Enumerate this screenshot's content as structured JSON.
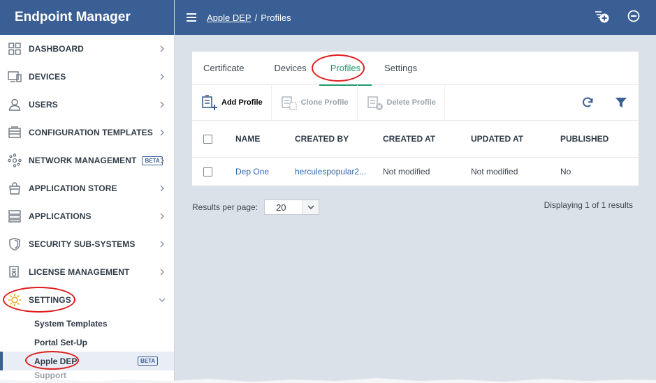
{
  "app": {
    "title": "Endpoint Manager"
  },
  "colors": {
    "brand": "#3a5f95",
    "accent_green": "#1e9a6a",
    "link": "#2f67a8",
    "annotation": "#e01b1b"
  },
  "sidebar": {
    "items": [
      {
        "label": "DASHBOARD",
        "icon": "dashboard-icon"
      },
      {
        "label": "DEVICES",
        "icon": "devices-icon"
      },
      {
        "label": "USERS",
        "icon": "user-icon"
      },
      {
        "label": "CONFIGURATION TEMPLATES",
        "icon": "templates-icon"
      },
      {
        "label": "NETWORK MANAGEMENT",
        "icon": "network-icon",
        "badge": "BETA"
      },
      {
        "label": "APPLICATION STORE",
        "icon": "store-icon"
      },
      {
        "label": "APPLICATIONS",
        "icon": "applications-icon"
      },
      {
        "label": "SECURITY SUB-SYSTEMS",
        "icon": "shield-icon"
      },
      {
        "label": "LICENSE MANAGEMENT",
        "icon": "license-icon"
      },
      {
        "label": "SETTINGS",
        "icon": "gear-icon",
        "expanded": true
      }
    ],
    "sub_items": [
      {
        "label": "System Templates"
      },
      {
        "label": "Portal Set-Up"
      },
      {
        "label": "Apple DEP",
        "badge": "BETA",
        "active": true
      },
      {
        "label": "Support"
      }
    ]
  },
  "header": {
    "breadcrumb_parent": "Apple DEP",
    "breadcrumb_separator": "/",
    "breadcrumb_current": "Profiles"
  },
  "tabs": [
    {
      "label": "Certificate"
    },
    {
      "label": "Devices"
    },
    {
      "label": "Profiles",
      "active": true
    },
    {
      "label": "Settings"
    }
  ],
  "toolbar": {
    "add_label": "Add Profile",
    "clone_label": "Clone Profile",
    "delete_label": "Delete Profile"
  },
  "table": {
    "columns": [
      "NAME",
      "CREATED BY",
      "CREATED AT",
      "UPDATED AT",
      "PUBLISHED"
    ],
    "rows": [
      {
        "name": "Dep One",
        "created_by": "herculespopular2...",
        "created_at": "Not modified",
        "updated_at": "Not modified",
        "published": "No"
      }
    ]
  },
  "pagination": {
    "results_label": "Results per page:",
    "per_page": "20",
    "display_text": "Displaying 1 of 1 results"
  }
}
